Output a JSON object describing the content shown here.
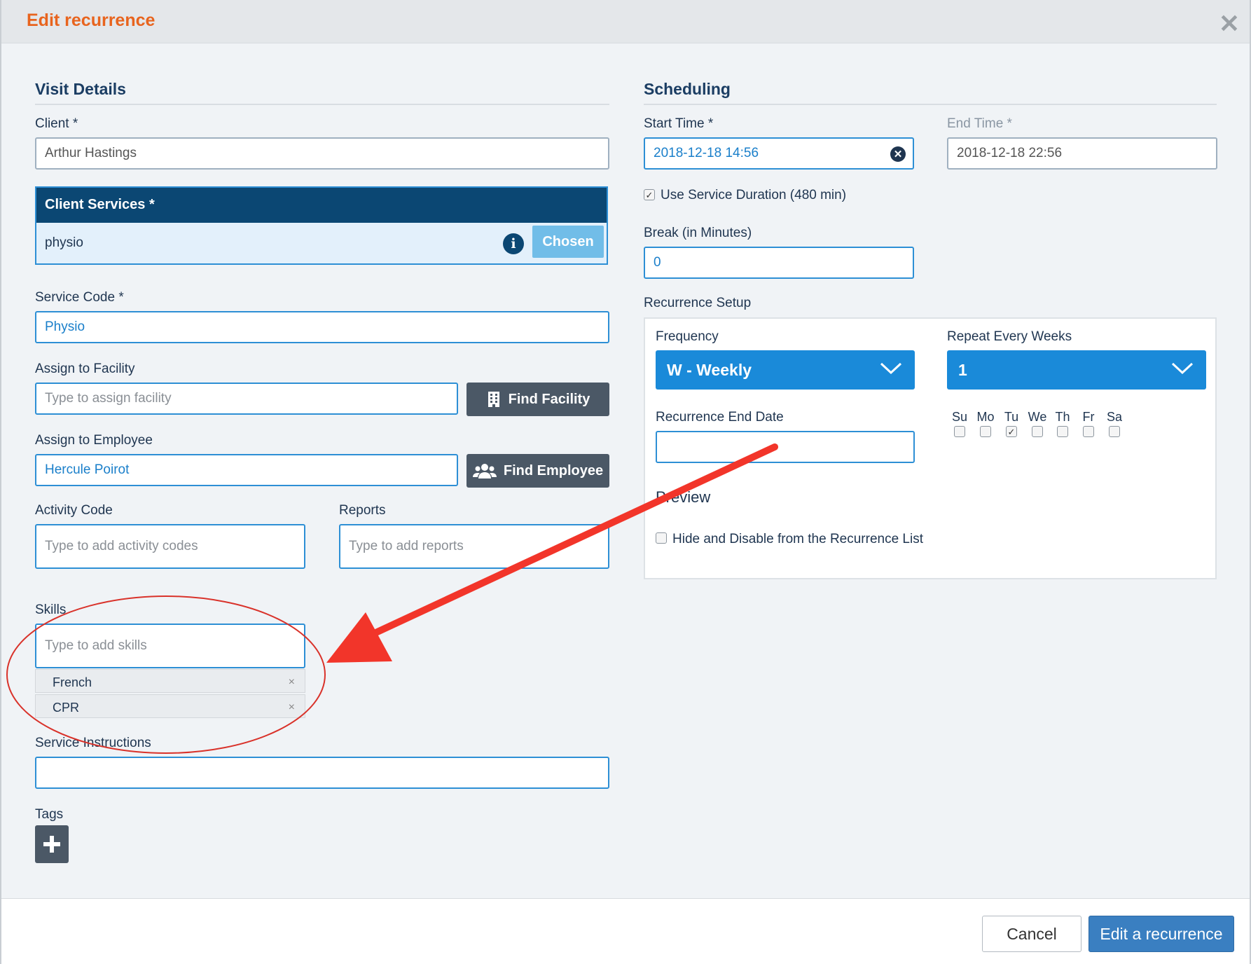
{
  "dialog": {
    "title": "Edit recurrence",
    "close_icon": "close-icon"
  },
  "visit": {
    "section_title": "Visit Details",
    "client": {
      "label": "Client *",
      "value": "Arthur Hastings"
    },
    "services": {
      "header": "Client Services *",
      "item": "physio",
      "info_icon": "info-icon",
      "chosen_label": "Chosen"
    },
    "service_code": {
      "label": "Service Code *",
      "value": "Physio"
    },
    "facility": {
      "label": "Assign to Facility",
      "placeholder": "Type to assign facility",
      "button": "Find Facility",
      "icon": "building-icon"
    },
    "employee": {
      "label": "Assign to Employee",
      "value": "Hercule Poirot",
      "button": "Find Employee",
      "icon": "users-icon"
    },
    "activity": {
      "label": "Activity Code",
      "placeholder": "Type to add activity codes"
    },
    "reports": {
      "label": "Reports",
      "placeholder": "Type to add reports"
    },
    "skills": {
      "label": "Skills",
      "placeholder": "Type to add skills",
      "items": [
        "French",
        "CPR"
      ],
      "remove_glyph": "×"
    },
    "instructions": {
      "label": "Service Instructions",
      "value": ""
    },
    "tags": {
      "label": "Tags",
      "add_icon": "plus-icon"
    }
  },
  "scheduling": {
    "section_title": "Scheduling",
    "start_time": {
      "label": "Start Time *",
      "value": "2018-12-18 14:56"
    },
    "end_time": {
      "label": "End Time *",
      "value": "2018-12-18 22:56"
    },
    "use_duration": {
      "label": "Use Service Duration (480 min)",
      "checked": true
    },
    "break": {
      "label": "Break (in Minutes)",
      "value": "0"
    },
    "recurrence": {
      "label": "Recurrence Setup",
      "frequency": {
        "label": "Frequency",
        "value": "W - Weekly"
      },
      "repeat": {
        "label": "Repeat Every Weeks",
        "value": "1"
      },
      "end_date": {
        "label": "Recurrence End Date",
        "value": ""
      },
      "days": [
        {
          "label": "Su",
          "checked": false
        },
        {
          "label": "Mo",
          "checked": false
        },
        {
          "label": "Tu",
          "checked": true
        },
        {
          "label": "We",
          "checked": false
        },
        {
          "label": "Th",
          "checked": false
        },
        {
          "label": "Fr",
          "checked": false
        },
        {
          "label": "Sa",
          "checked": false
        }
      ],
      "preview_label": "Preview",
      "hide_option": {
        "label": "Hide and Disable from the Recurrence List",
        "checked": false
      }
    }
  },
  "footer": {
    "cancel": "Cancel",
    "submit": "Edit a recurrence"
  },
  "annotation": {
    "arrow_color": "#f2352a",
    "circle_color": "#d9322a"
  }
}
